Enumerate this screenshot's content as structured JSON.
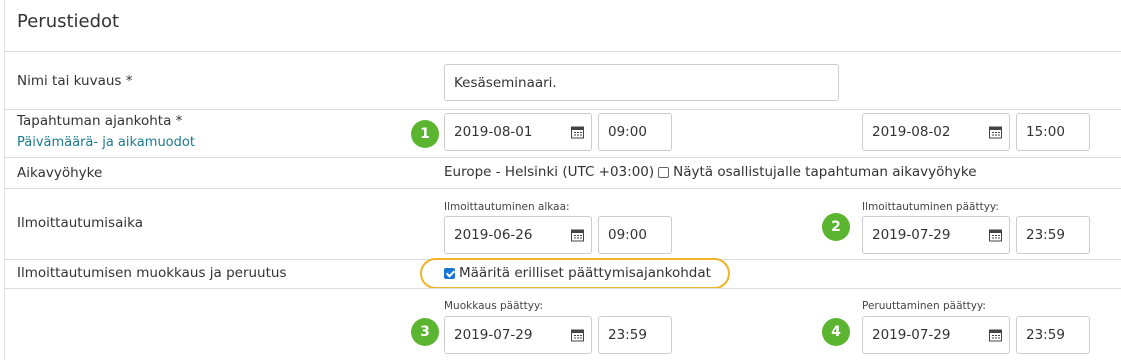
{
  "section": {
    "title": "Perustiedot"
  },
  "name_row": {
    "label": "Nimi tai kuvaus *",
    "value": "Kesäseminaari."
  },
  "event_time": {
    "label": "Tapahtuman ajankohta *",
    "link": "Päivämäärä- ja aikamuodot",
    "badge": "1",
    "start_date": "2019-08-01",
    "start_time": "09:00",
    "end_date": "2019-08-02",
    "end_time": "15:00"
  },
  "timezone": {
    "label": "Aikavyöhyke",
    "value": "Europe - Helsinki (UTC +03:00)",
    "show_label": "Näytä osallistujalle tapahtuman aikavyöhyke",
    "show_checked": false
  },
  "registration": {
    "label": "Ilmoittautumisaika",
    "start_caption": "Ilmoittautuminen alkaa:",
    "start_date": "2019-06-26",
    "start_time": "09:00",
    "end_caption": "Ilmoittautuminen päättyy:",
    "end_badge": "2",
    "end_date": "2019-07-29",
    "end_time": "23:59"
  },
  "modify": {
    "label": "Ilmoittautumisen muokkaus ja peruutus",
    "separate_label": "Määritä erilliset päättymisajankohdat",
    "separate_checked": true,
    "edit_caption": "Muokkaus päättyy:",
    "edit_badge": "3",
    "edit_date": "2019-07-29",
    "edit_time": "23:59",
    "cancel_caption": "Peruuttaminen päättyy:",
    "cancel_badge": "4",
    "cancel_date": "2019-07-29",
    "cancel_time": "23:59"
  },
  "colors": {
    "badge": "#5cb531",
    "highlight": "#f0b429",
    "link": "#1a7a8a",
    "checkbox": "#1976d2"
  },
  "icons": {
    "date_picker": "calendar-icon"
  }
}
